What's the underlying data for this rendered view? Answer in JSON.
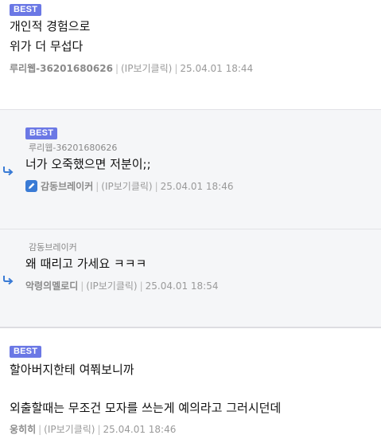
{
  "comments": [
    {
      "best": "BEST",
      "lines": [
        "개인적 경험으로",
        "위가 더 무섭다"
      ],
      "nick": "루리웹-36201680626",
      "ip": "(IP보기클릭)",
      "time": "25.04.01  18:44"
    },
    {
      "best": "BEST",
      "mention": "루리웹-36201680626",
      "lines": [
        "너가 오죽했으면 저분이;;"
      ],
      "nick_icon": "pen-icon",
      "nick": "감동브레이커",
      "ip": "(IP보기클릭)",
      "time": "25.04.01  18:46"
    },
    {
      "mention": "감동브레이커",
      "lines": [
        "왜 때리고 가세요 ㅋㅋㅋ"
      ],
      "nick": "악령의멜로디",
      "ip": "(IP보기클릭)",
      "time": "25.04.01  18:54"
    },
    {
      "best": "BEST",
      "lines": [
        "할아버지한테 여쭤보니까",
        "외출할때는 무조건 모자를 쓰는게 예의라고 그러시던데"
      ],
      "nick": "웅히히",
      "ip": "(IP보기클릭)",
      "time": "25.04.01  18:46"
    }
  ],
  "colors": {
    "best_badge": "#6b78e5",
    "reply_arrow": "#3a7bd5",
    "reply_bg": "#f5f6f8"
  }
}
